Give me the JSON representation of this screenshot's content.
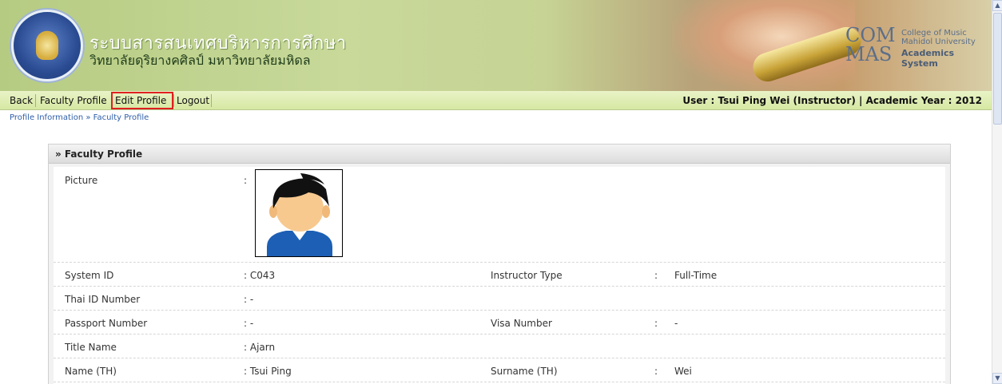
{
  "banner": {
    "title_th": "ระบบสารสนเทศบริหารการศึกษา",
    "subtitle_th": "วิทยาลัยดุริยางคศิลป์ มหาวิทยาลัยมหิดล",
    "brand_com": "COM",
    "brand_mas": "MAS",
    "brand_college": "College of Music",
    "brand_university": "Mahidol University",
    "brand_system": "Academics System"
  },
  "nav": {
    "items": [
      {
        "label": "Back"
      },
      {
        "label": "Faculty Profile"
      },
      {
        "label": "Edit Profile"
      },
      {
        "label": "Logout"
      }
    ],
    "user_info": "User : Tsui Ping Wei (Instructor) | Academic Year : 2012"
  },
  "breadcrumb": "Profile Information » Faculty Profile",
  "panel": {
    "title": "» Faculty Profile",
    "picture_label": "Picture",
    "rows": [
      {
        "left_label": "System ID",
        "left_value": ": C043",
        "right_label": "Instructor Type",
        "right_sep": ":",
        "right_value": "Full-Time"
      },
      {
        "left_label": "Thai ID Number",
        "left_value": ": -",
        "right_label": "",
        "right_sep": "",
        "right_value": ""
      },
      {
        "left_label": "Passport Number",
        "left_value": ": -",
        "right_label": "Visa Number",
        "right_sep": ":",
        "right_value": "-"
      },
      {
        "left_label": "Title Name",
        "left_value": ": Ajarn",
        "right_label": "",
        "right_sep": "",
        "right_value": ""
      },
      {
        "left_label": "Name (TH)",
        "left_value": ": Tsui Ping",
        "right_label": "Surname (TH)",
        "right_sep": ":",
        "right_value": "Wei"
      }
    ]
  },
  "icons": [
    "university-seal-icon",
    "avatar-icon",
    "scroll-up-icon",
    "scroll-down-icon"
  ],
  "colors": {
    "nav_bg": "#d6e8a2",
    "highlight": "#e02020",
    "link": "#2f5fa8"
  }
}
